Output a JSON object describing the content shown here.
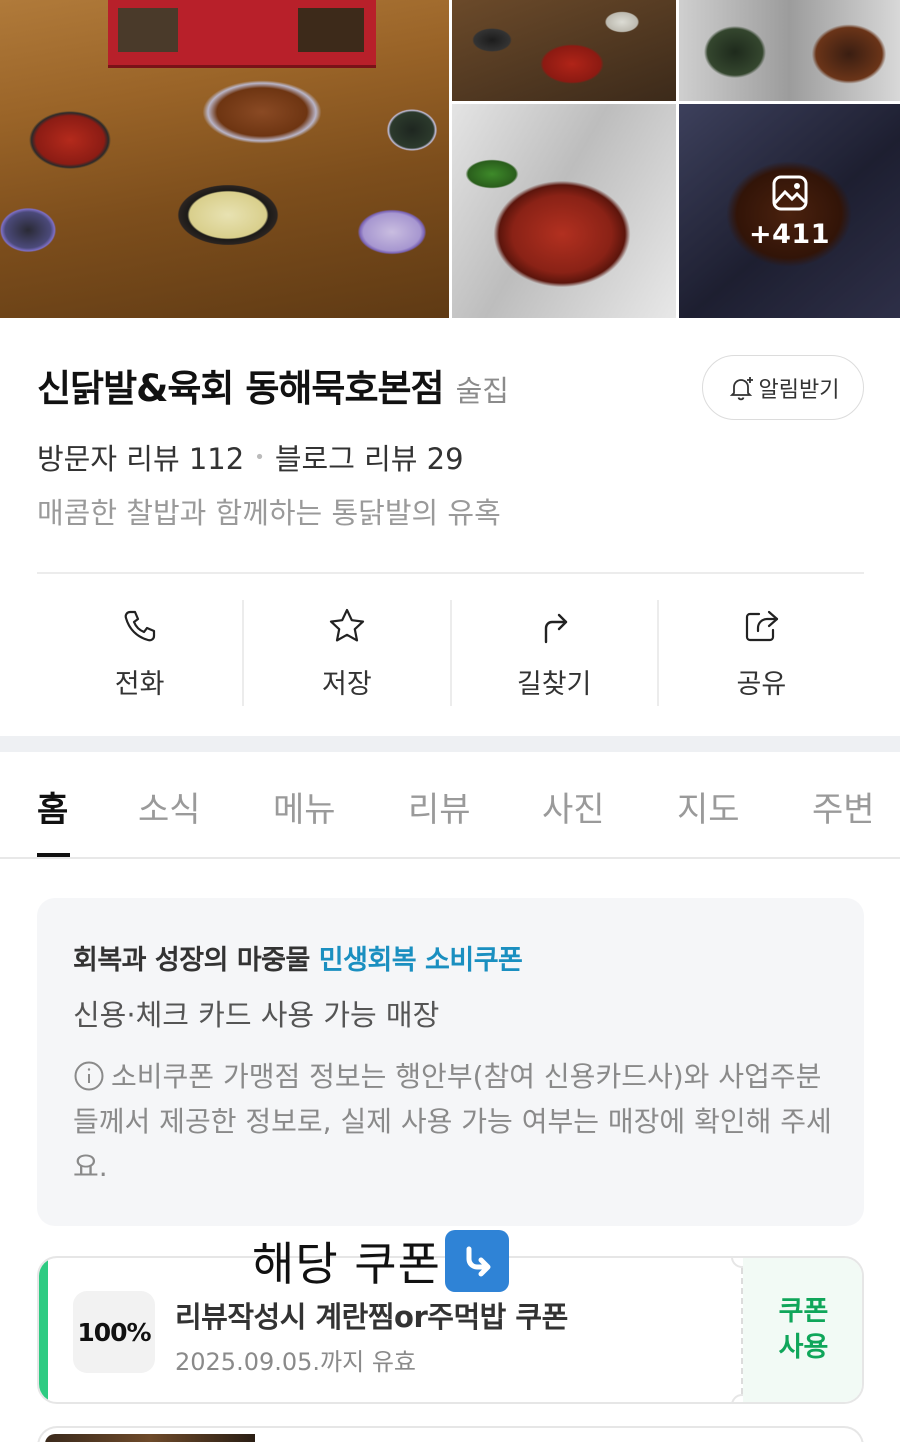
{
  "gallery": {
    "more_photos": "+411"
  },
  "place": {
    "name": "신닭발&육회 동해묵호본점",
    "category": "술집",
    "notify_label": "알림받기",
    "visitor_review": "방문자 리뷰 112",
    "blog_review": "블로그 리뷰 29",
    "tagline": "매콤한 찰밥과 함께하는 통닭발의 유혹"
  },
  "actions": [
    {
      "label": "전화",
      "icon": "phone-icon"
    },
    {
      "label": "저장",
      "icon": "star-icon"
    },
    {
      "label": "길찾기",
      "icon": "directions-icon"
    },
    {
      "label": "공유",
      "icon": "share-icon"
    }
  ],
  "tabs": [
    "홈",
    "소식",
    "메뉴",
    "리뷰",
    "사진",
    "지도",
    "주변"
  ],
  "active_tab": "홈",
  "info_box": {
    "headline_prefix": "회복과 성장의 마중물",
    "headline_highlight": "민생회복 소비쿠폰",
    "sub": "신용·체크 카드 사용 가능 매장",
    "note": "소비쿠폰 가맹점 정보는 행안부(참여 신용카드사)와 사업주분들께서 제공한 정보로, 실제 사용 가능 여부는 매장에 확인해 주세요."
  },
  "annotation": {
    "text": "해당 쿠폰",
    "arrow_icon": "arrow-down-right-icon"
  },
  "coupon": {
    "badge": "100%",
    "title": "리뷰작성시 계란찜or주먹밥 쿠폰",
    "expire": "2025.09.05.까지 유효",
    "use_line1": "쿠폰",
    "use_line2": "사용"
  },
  "colors": {
    "accent_blue": "#1a8fc0",
    "coupon_green": "#10a65a",
    "coupon_bar": "#2ecb82",
    "arrow_emoji_bg": "#2f83d6"
  }
}
